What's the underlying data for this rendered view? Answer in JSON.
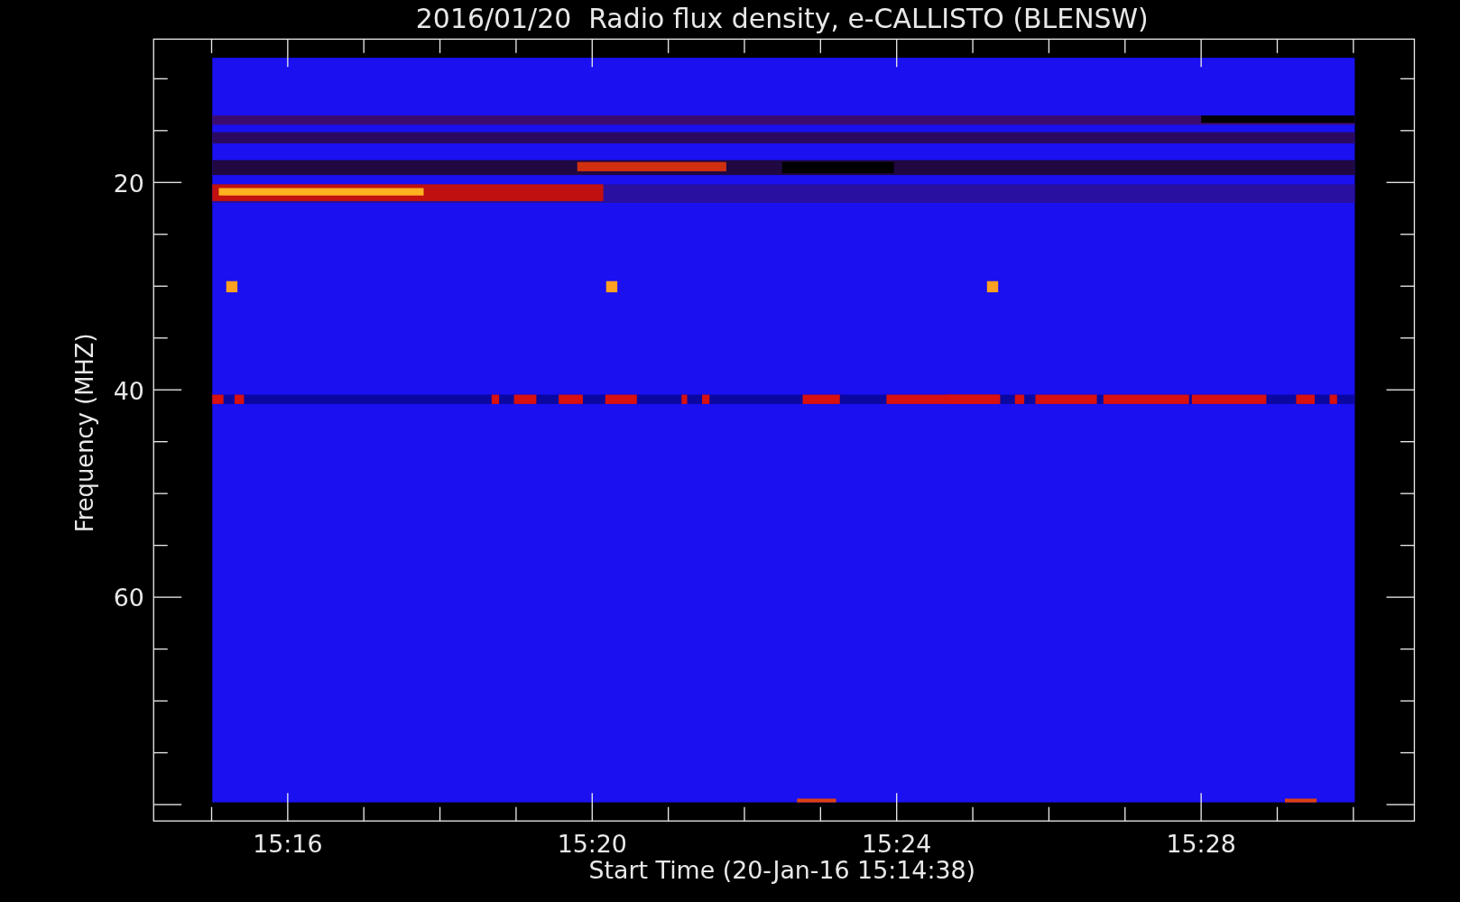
{
  "title": "2016/01/20  Radio flux density, e-CALLISTO (BLENSW)",
  "y_axis": {
    "label": "Frequency (MHZ)",
    "ticks": [
      "20",
      "40",
      "60"
    ]
  },
  "x_axis": {
    "label": "Start Time (20-Jan-16 15:14:38)",
    "ticks": [
      "15:16",
      "15:20",
      "15:24",
      "15:28"
    ]
  }
}
